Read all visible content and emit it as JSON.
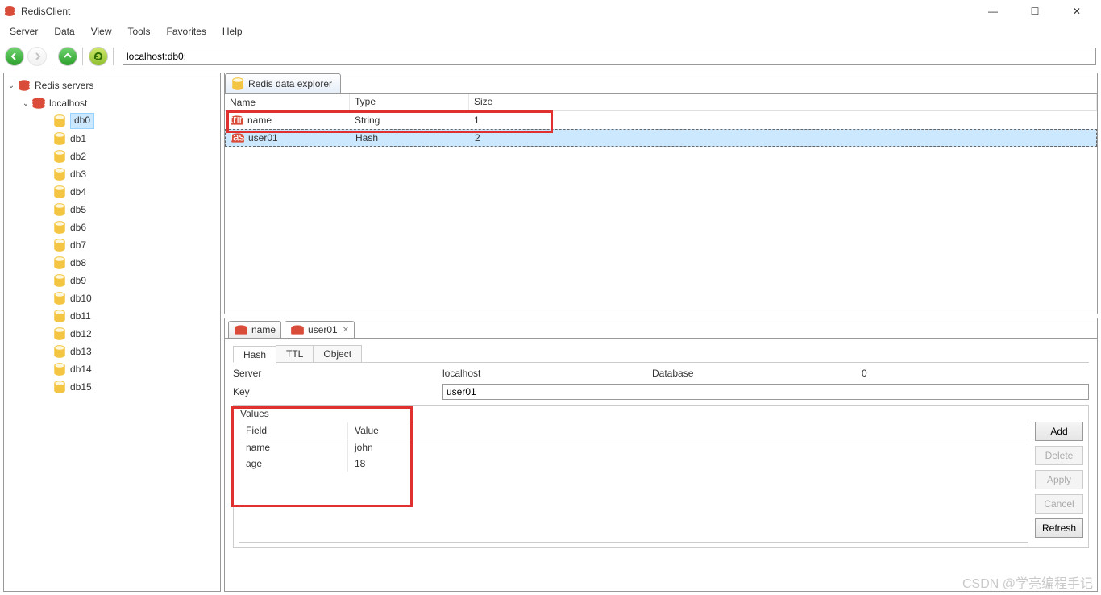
{
  "title": "RedisClient",
  "menu": [
    "Server",
    "Data",
    "View",
    "Tools",
    "Favorites",
    "Help"
  ],
  "address": "localhost:db0:",
  "tree": {
    "root": "Redis servers",
    "server": "localhost",
    "databases": [
      "db0",
      "db1",
      "db2",
      "db3",
      "db4",
      "db5",
      "db6",
      "db7",
      "db8",
      "db9",
      "db10",
      "db11",
      "db12",
      "db13",
      "db14",
      "db15"
    ],
    "selected": "db0"
  },
  "explorer": {
    "tab": "Redis data explorer",
    "cols": [
      "Name",
      "Type",
      "Size"
    ],
    "rows": [
      {
        "name": "name",
        "type": "String",
        "size": "1",
        "icon": "string"
      },
      {
        "name": "user01",
        "type": "Hash",
        "size": "2",
        "icon": "hash",
        "selected": true
      }
    ]
  },
  "detail": {
    "tabs": [
      {
        "label": "name",
        "icon": "string"
      },
      {
        "label": "user01",
        "icon": "hash",
        "active": true,
        "closable": true
      }
    ],
    "subtabs": [
      "Hash",
      "TTL",
      "Object"
    ],
    "active_subtab": "Hash",
    "server_label": "Server",
    "server_value": "localhost",
    "database_label": "Database",
    "database_value": "0",
    "key_label": "Key",
    "key_value": "user01",
    "values_title": "Values",
    "values_cols": [
      "Field",
      "Value"
    ],
    "values_rows": [
      {
        "field": "name",
        "value": "john"
      },
      {
        "field": "age",
        "value": "18"
      }
    ],
    "buttons": [
      "Add",
      "Delete",
      "Apply",
      "Cancel",
      "Refresh"
    ]
  },
  "watermark": "CSDN @学亮编程手记"
}
